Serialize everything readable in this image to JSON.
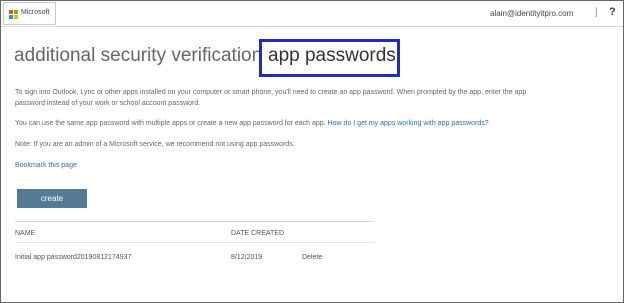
{
  "header": {
    "brand": "Microsoft",
    "user_email": "alain@identityitpro.com",
    "separator": "|",
    "help_label": "?"
  },
  "page": {
    "title_prefix": "additional security verification",
    "title_active": "app passwords",
    "highlight_color": "#1f2db8"
  },
  "content": {
    "para1_line1": "To sign into Outlook, Lync or other apps installed on your computer or smart phone, you'll need to create an app password. When prompted by the app, enter the app",
    "para1_line2": "password instead of your work or school account password.",
    "para2_text": "You can use the same app password with multiple apps or create a new app password for each app.",
    "para2_link": "How do I get my apps working with app passwords?",
    "note": "Note: If you are an admin of a Microsoft service, we recommend not using app passwords.",
    "bookmark_link": "Bookmark this page",
    "create_label": "create"
  },
  "table": {
    "headers": [
      "NAME",
      "DATE CREATED"
    ],
    "rows": [
      {
        "name": "Initial app password20190812174937",
        "date": "8/12/2019",
        "action": "Delete"
      }
    ]
  }
}
